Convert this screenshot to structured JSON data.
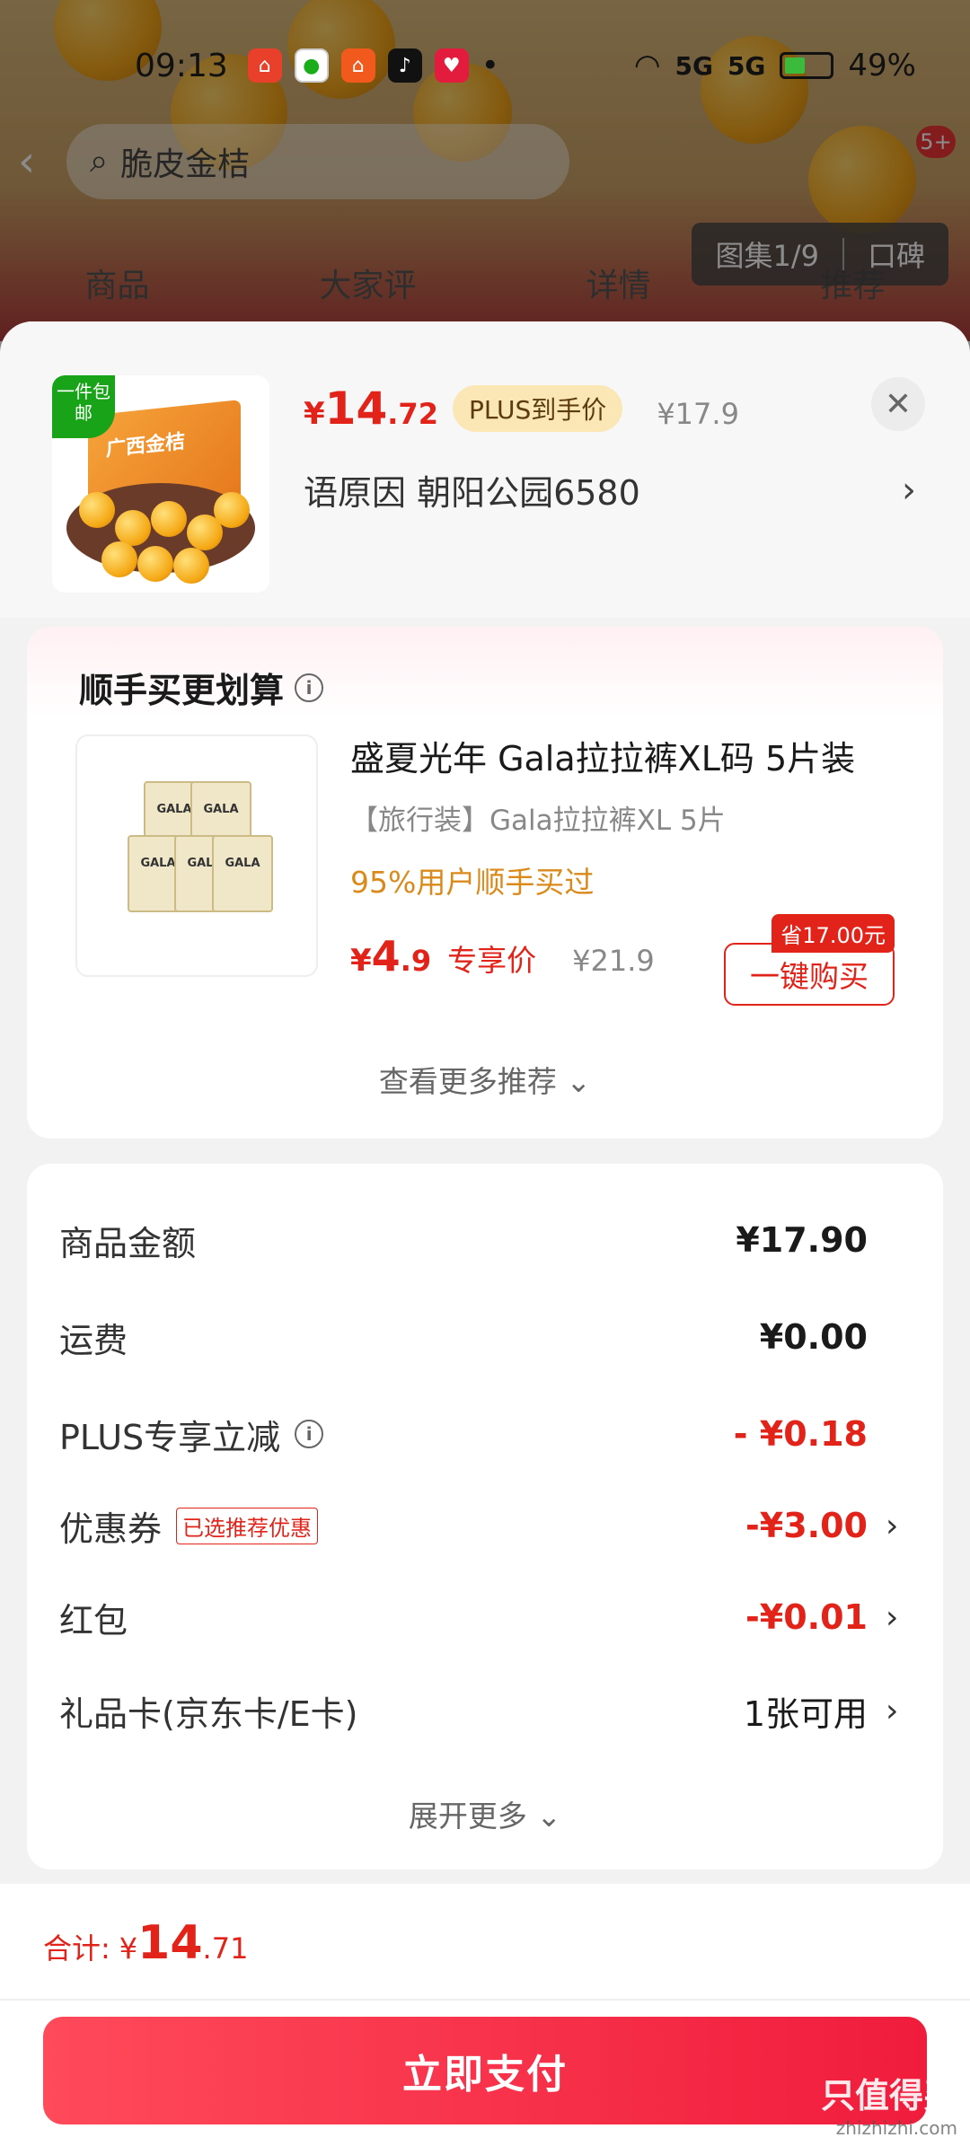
{
  "status_bar": {
    "time": "09:13",
    "battery": "49%",
    "network_1": "5G",
    "network_2": "5G"
  },
  "background_page": {
    "search_text": "脆皮金桔",
    "tabs": [
      "商品",
      "大家评",
      "详情",
      "推荐"
    ],
    "gallery_label": "图集1/9",
    "reviews_label": "口碑",
    "cart_badge": "5+"
  },
  "product": {
    "thumb_tag": "一件包邮",
    "thumb_box_label": "广西金桔",
    "price_currency": "¥",
    "price_int": "14",
    "price_dec": ".72",
    "plus_label": "PLUS到手价",
    "original_price": "¥17.9",
    "address": "语原因 朝阳公园6580"
  },
  "upsell": {
    "title": "顺手买更划算",
    "item_name": "盛夏光年 Gala拉拉裤XL码 5片装",
    "item_sub": "【旅行装】Gala拉拉裤XL 5片",
    "hint": "95%用户顺手买过",
    "price_currency": "¥",
    "price_int": "4",
    "price_dec": ".9",
    "price_label": "专享价",
    "original_price": "¥21.9",
    "save_tag": "省17.00元",
    "buy_label": "一键购买",
    "more_label": "查看更多推荐 ⌄"
  },
  "costs": {
    "rows": [
      {
        "label": "商品金额",
        "value": "¥17.90"
      },
      {
        "label": "运费",
        "value": "¥0.00"
      },
      {
        "label": "PLUS专享立减",
        "value": "- ¥0.18"
      },
      {
        "label": "优惠券",
        "tag": "已选推荐优惠",
        "value": "-¥3.00"
      },
      {
        "label": "红包",
        "value": "-¥0.01"
      },
      {
        "label": "礼品卡(京东卡/E卡)",
        "value": "1张可用"
      }
    ],
    "expand_label": "展开更多 ⌄"
  },
  "footer": {
    "total_label": "合计:",
    "total_currency": "¥",
    "total_int": "14",
    "total_dec": ".71",
    "pay_label": "立即支付"
  },
  "watermark": {
    "text": "只值得买",
    "url": "zhizhizhi.com"
  },
  "colors": {
    "accent_red": "#e2231a",
    "plus_gold": "#fbe6b5",
    "hint_orange": "#d98a1a"
  }
}
